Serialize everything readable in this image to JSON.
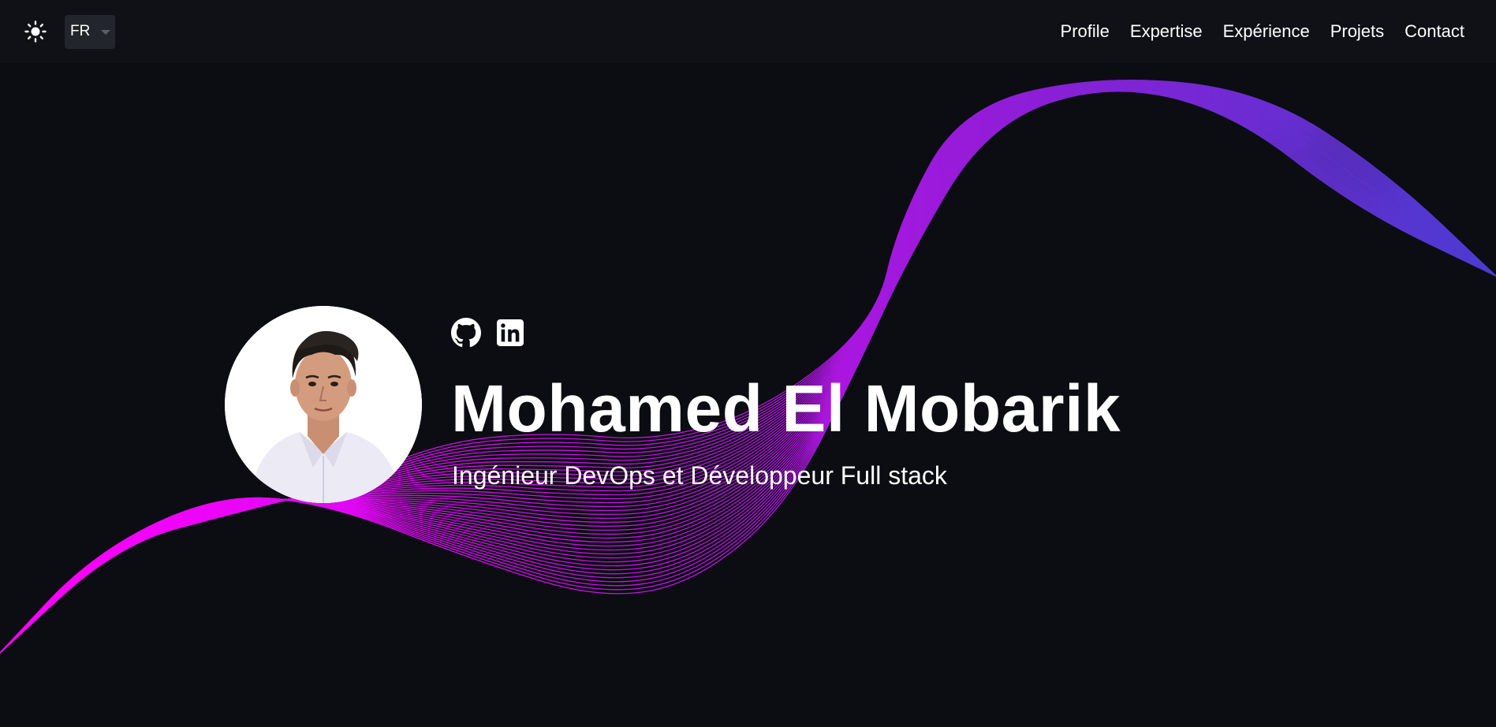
{
  "header": {
    "theme_icon": "sun-icon",
    "language": {
      "selected": "FR",
      "options": [
        "FR"
      ]
    },
    "nav": [
      {
        "label": "Profile"
      },
      {
        "label": "Expertise"
      },
      {
        "label": "Expérience"
      },
      {
        "label": "Projets"
      },
      {
        "label": "Contact"
      }
    ]
  },
  "hero": {
    "name": "Mohamed El Mobarik",
    "role": "Ingénieur DevOps et Développeur Full stack",
    "socials": [
      {
        "icon": "github-icon"
      },
      {
        "icon": "linkedin-icon"
      }
    ]
  },
  "colors": {
    "background": "#0b0d12",
    "topbar": "#0f1116",
    "wave_start": "#ff00ff",
    "wave_mid": "#8a1fd6",
    "wave_end": "#4a3bd0"
  }
}
